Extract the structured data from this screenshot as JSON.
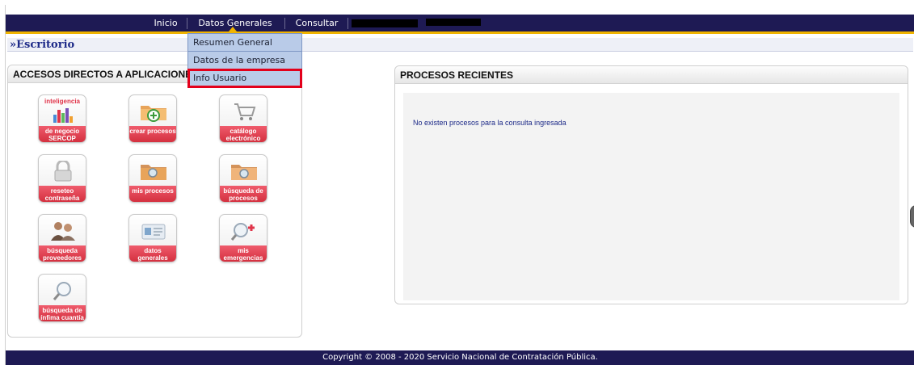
{
  "nav": {
    "items": [
      "Inicio",
      "Datos Generales",
      "Consultar"
    ],
    "redacted_1": "[unclear]",
    "redacted_2": "[unclear]"
  },
  "breadcrumb": "»Escritorio",
  "dropdown": {
    "items": [
      "Resumen General",
      "Datos de la empresa",
      "Info Usuario"
    ],
    "highlighted_index": 2,
    "highlight_color": "#e3001b"
  },
  "left_panel": {
    "title": "ACCESOS DIRECTOS A APLICACIONES",
    "tiles": [
      {
        "icon": "bar-chart-icon",
        "top_text": "inteligencia",
        "mid_text": "",
        "label": "de negocio SERCOP"
      },
      {
        "icon": "folder-add-icon",
        "top_text": "",
        "mid_text": "",
        "label": "crear procesos"
      },
      {
        "icon": "shopping-cart-icon",
        "top_text": "",
        "mid_text": "",
        "label": "catálogo electrónico"
      },
      {
        "icon": "padlock-icon",
        "top_text": "",
        "mid_text": "",
        "label": "reseteo contraseña"
      },
      {
        "icon": "folder-search-icon",
        "top_text": "",
        "mid_text": "",
        "label": "mis procesos"
      },
      {
        "icon": "folder-search-icon",
        "top_text": "",
        "mid_text": "",
        "label": "búsqueda de procesos"
      },
      {
        "icon": "people-icon",
        "top_text": "",
        "mid_text": "",
        "label": "búsqueda proveedores"
      },
      {
        "icon": "id-card-icon",
        "top_text": "",
        "mid_text": "",
        "label": "datos generales"
      },
      {
        "icon": "magnifier-cross-icon",
        "top_text": "",
        "mid_text": "",
        "label": "mis emergencias"
      },
      {
        "icon": "magnifier-icon",
        "top_text": "",
        "mid_text": "",
        "label": "búsqueda de ínfima cuantía"
      }
    ]
  },
  "right_panel": {
    "title": "PROCESOS RECIENTES",
    "empty_message": "No existen procesos para la consulta ingresada"
  },
  "footer": "Copyright © 2008 - 2020 Servicio Nacional de Contratación Pública.",
  "colors": {
    "nav_bg": "#1e1a54",
    "nav_accent": "#f0b400",
    "tile_label": "#d4303f",
    "link_blue": "#1d2a88"
  }
}
